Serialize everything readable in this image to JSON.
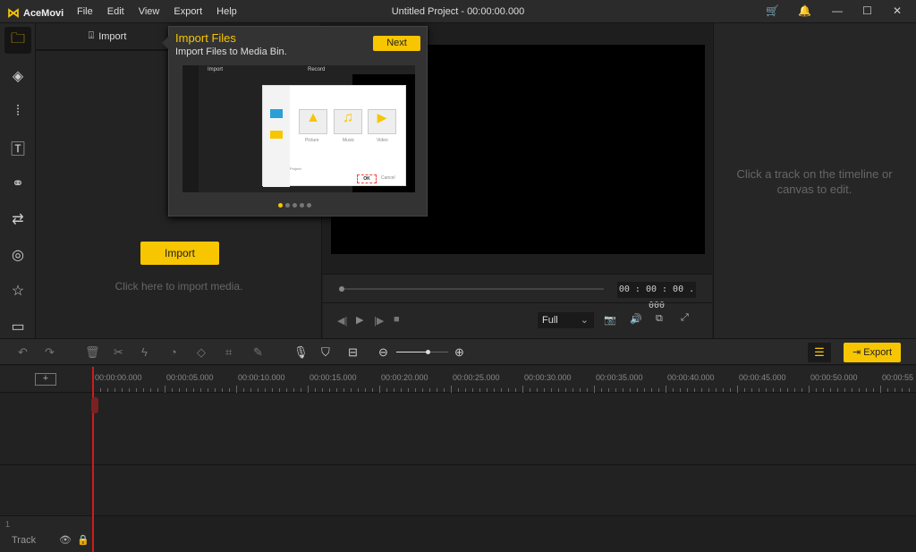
{
  "app": {
    "name": "AceMovi",
    "title": "Untitled Project - 00:00:00.000",
    "menu": [
      "File",
      "Edit",
      "View",
      "Export",
      "Help"
    ]
  },
  "colors": {
    "accent": "#f7c600",
    "background": "#1f1f1f"
  },
  "sidebar": [
    "folder-icon",
    "layers-icon",
    "audio-icon",
    "text-icon",
    "filters-icon",
    "transitions-icon",
    "overlay-icon",
    "sticker-icon",
    "inbox-icon"
  ],
  "media": {
    "tab": "Import",
    "button": "Import",
    "hint": "Click here to import media."
  },
  "popup": {
    "title": "Import Files",
    "subtitle": "Import Files to Media Bin.",
    "next": "Next",
    "mock": {
      "import": "Import",
      "record": "Record",
      "picture": "Picture",
      "music": "Music",
      "video": "Video",
      "project": "Project:",
      "ok": "OK",
      "cancel": "Cancel"
    },
    "page": 1,
    "pages": 5
  },
  "preview": {
    "time": "00 : 00 : 00 . 000",
    "zoom": "Full",
    "progress": 0
  },
  "right": {
    "hint": "Click a track on the timeline or canvas to edit."
  },
  "toolbar": {
    "export": "Export",
    "zoom_level": 0.6
  },
  "ruler": [
    "00:00:00.000",
    "00:00:05.000",
    "00:00:10.000",
    "00:00:15.000",
    "00:00:20.000",
    "00:00:25.000",
    "00:00:30.000",
    "00:00:35.000",
    "00:00:40.000",
    "00:00:45.000",
    "00:00:50.000",
    "00:00:55"
  ],
  "track": {
    "number": "1",
    "label": "Track"
  }
}
